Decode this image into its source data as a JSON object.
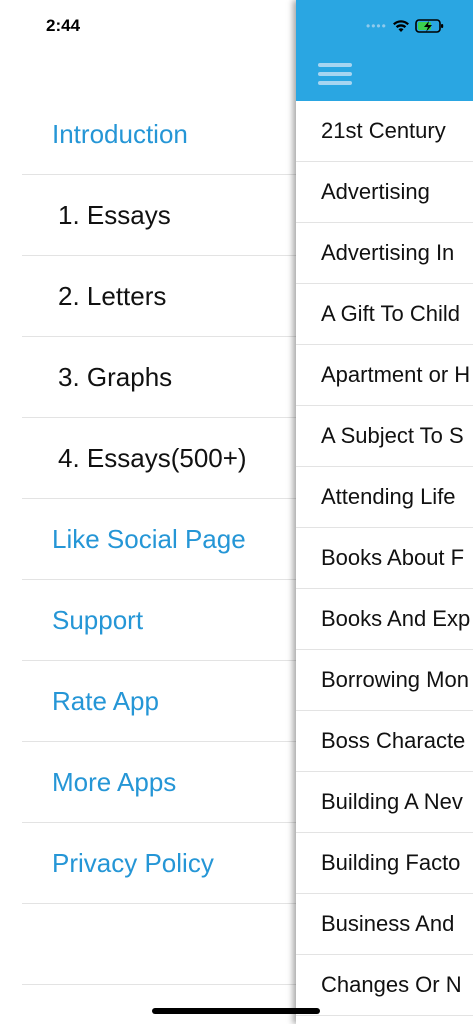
{
  "status": {
    "time": "2:44"
  },
  "menu": {
    "items": [
      {
        "label": "Introduction",
        "kind": "link"
      },
      {
        "label": "1. Essays",
        "kind": "sub"
      },
      {
        "label": "2. Letters",
        "kind": "sub"
      },
      {
        "label": "3. Graphs",
        "kind": "sub"
      },
      {
        "label": "4. Essays(500+)",
        "kind": "sub"
      },
      {
        "label": "Like Social Page",
        "kind": "link"
      },
      {
        "label": "Support",
        "kind": "link"
      },
      {
        "label": "Rate App",
        "kind": "link"
      },
      {
        "label": "More Apps",
        "kind": "link"
      },
      {
        "label": "Privacy Policy",
        "kind": "link"
      }
    ]
  },
  "topics": [
    "21st Century",
    "Advertising",
    "Advertising In",
    "A Gift To Child",
    "Apartment or H",
    "A Subject To S",
    "Attending Life",
    "Books About F",
    "Books And Exp",
    "Borrowing Mon",
    "Boss Characte",
    "Building A Nev",
    "Building Facto",
    "Business And",
    "Changes Or N"
  ],
  "colors": {
    "accent": "#2aa6e2",
    "link": "#2596d6"
  },
  "icons": {
    "menu": "hamburger-icon",
    "wifi": "wifi-icon",
    "battery": "battery-charging-icon",
    "signal": "cellular-signal-icon"
  }
}
